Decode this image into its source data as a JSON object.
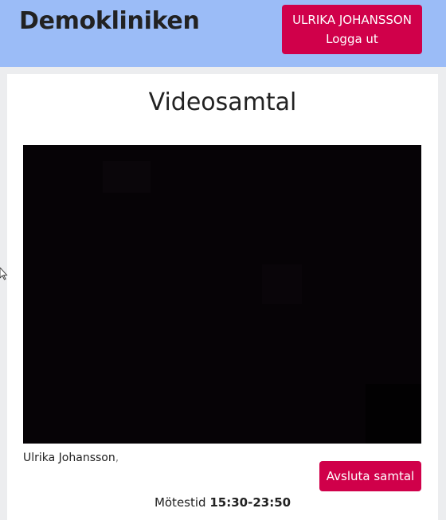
{
  "header": {
    "brand": "Demokliniken",
    "user_name": "ULRIKA JOHANSSON",
    "logout_label": "Logga ut",
    "background": "#9bbcf7",
    "accent": "#d0004a"
  },
  "main": {
    "title": "Videosamtal",
    "participant_name": "Ulrika Johansson",
    "participant_separator": ",",
    "end_call_label": "Avsluta samtal",
    "meeting_time_label": "Mötestid",
    "meeting_time_value": "15:30-23:50"
  },
  "icons": {
    "cursor": "mouse-pointer-icon"
  }
}
